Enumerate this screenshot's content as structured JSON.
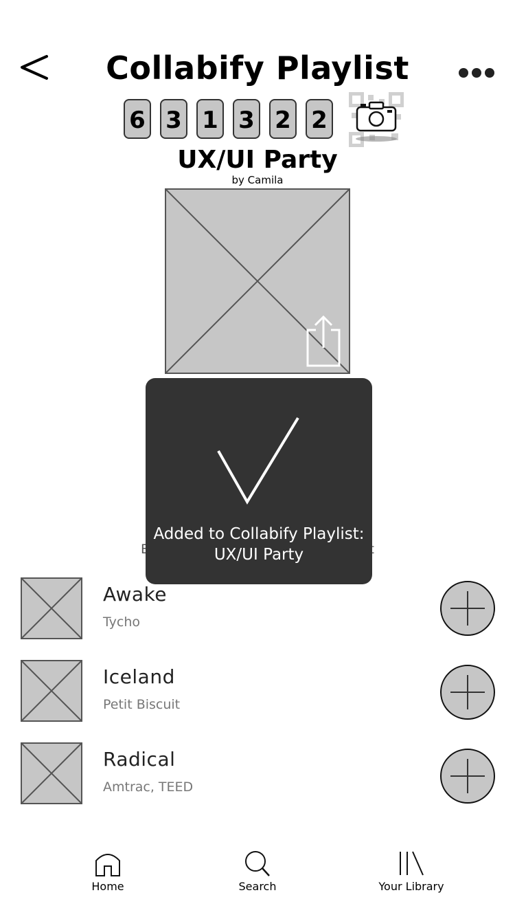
{
  "header": {
    "title": "Collabify Playlist"
  },
  "session_code": [
    "6",
    "3",
    "1",
    "3",
    "2",
    "2"
  ],
  "playlist": {
    "name": "UX/UI Party",
    "owner": "by Camila"
  },
  "toast": {
    "message": "Added to Collabify Playlist: UX/UI Party"
  },
  "obscured_button": {
    "left_fragment": "E",
    "right_fragment": "t"
  },
  "tracks": [
    {
      "title": "Awake",
      "artist": "Tycho"
    },
    {
      "title": "Iceland",
      "artist": "Petit Biscuit"
    },
    {
      "title": "Radical",
      "artist": "Amtrac, TEED"
    }
  ],
  "bottom_nav": {
    "home": "Home",
    "search": "Search",
    "library": "Your Library"
  },
  "icons": {
    "back": "back-chevron-icon",
    "more": "more-horizontal-icon",
    "qr": "qr-camera-icon",
    "share": "share-icon",
    "check": "checkmark-icon",
    "add": "plus-circle-icon",
    "home": "home-icon",
    "search": "search-icon",
    "library": "library-icon"
  },
  "colors": {
    "placeholder_fill": "#c6c6c6",
    "toast_bg": "#333333",
    "toast_text": "#ffffff"
  }
}
